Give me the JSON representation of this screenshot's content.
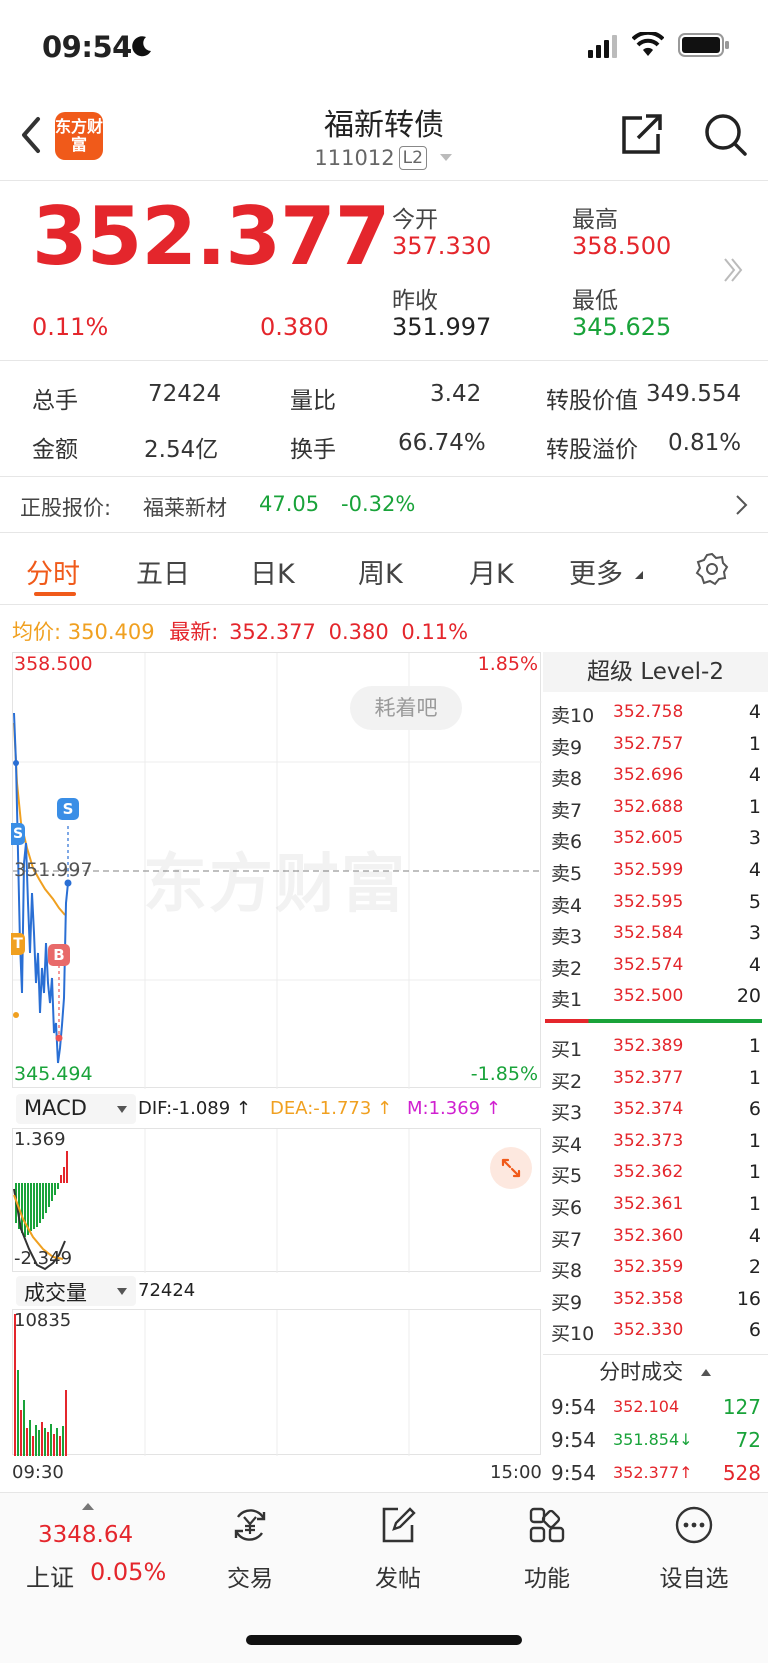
{
  "status_bar": {
    "time": "09:54"
  },
  "header": {
    "logo_text": "东方财富",
    "title": "福新转债",
    "code": "111012",
    "level_badge": "L2"
  },
  "quote": {
    "price": "352.377",
    "change_pct": "0.11%",
    "change": "0.380",
    "open_label": "今开",
    "open": "357.330",
    "high_label": "最高",
    "high": "358.500",
    "prev_close_label": "昨收",
    "prev_close": "351.997",
    "low_label": "最低",
    "low": "345.625"
  },
  "stats": {
    "volume_label": "总手",
    "volume": "72424",
    "vol_ratio_label": "量比",
    "vol_ratio": "3.42",
    "conv_value_label": "转股价值",
    "conv_value": "349.554",
    "amount_label": "金额",
    "amount": "2.54亿",
    "turnover_label": "换手",
    "turnover": "66.74%",
    "premium_label": "转股溢价",
    "premium": "0.81%"
  },
  "underlying": {
    "label": "正股报价:",
    "name": "福莱新材",
    "price": "47.05",
    "change_pct": "-0.32%"
  },
  "tabs": [
    {
      "label": "分时",
      "active": true
    },
    {
      "label": "五日",
      "active": false
    },
    {
      "label": "日K",
      "active": false
    },
    {
      "label": "周K",
      "active": false
    },
    {
      "label": "月K",
      "active": false
    },
    {
      "label": "更多",
      "active": false
    }
  ],
  "chart_header": {
    "avg_label": "均价:",
    "avg_value": "350.409",
    "latest_label": "最新:",
    "latest_value": "352.377",
    "latest_change": "0.380",
    "latest_pct": "0.11%"
  },
  "chart": {
    "top_price": "358.500",
    "top_pct": "1.85%",
    "mid_price": "351.997",
    "bottom_price": "345.494",
    "bottom_pct": "-1.85%",
    "bubble": "耗着吧",
    "watermark": "东方财富",
    "marker_s": "S",
    "marker_b": "B",
    "marker_t": "T",
    "time_start": "09:30",
    "time_end": "15:00"
  },
  "chart_data": {
    "type": "line",
    "ylim": [
      345.494,
      358.5
    ],
    "series": []
  },
  "macd": {
    "selector": "MACD",
    "dif": "DIF:-1.089 ↑",
    "dea": "DEA:-1.773 ↑",
    "m": "M:1.369 ↑",
    "top": "1.369",
    "bottom": "-2.349"
  },
  "volume_panel": {
    "selector": "成交量",
    "value": "72424",
    "top": "10835"
  },
  "order_book": {
    "title": "超级 Level-2",
    "asks": [
      {
        "label": "卖10",
        "price": "352.758",
        "qty": "4"
      },
      {
        "label": "卖9",
        "price": "352.757",
        "qty": "1"
      },
      {
        "label": "卖8",
        "price": "352.696",
        "qty": "4"
      },
      {
        "label": "卖7",
        "price": "352.688",
        "qty": "1"
      },
      {
        "label": "卖6",
        "price": "352.605",
        "qty": "3"
      },
      {
        "label": "卖5",
        "price": "352.599",
        "qty": "4"
      },
      {
        "label": "卖4",
        "price": "352.595",
        "qty": "5"
      },
      {
        "label": "卖3",
        "price": "352.584",
        "qty": "3"
      },
      {
        "label": "卖2",
        "price": "352.574",
        "qty": "4"
      },
      {
        "label": "卖1",
        "price": "352.500",
        "qty": "20"
      }
    ],
    "bids": [
      {
        "label": "买1",
        "price": "352.389",
        "qty": "1"
      },
      {
        "label": "买2",
        "price": "352.377",
        "qty": "1"
      },
      {
        "label": "买3",
        "price": "352.374",
        "qty": "6"
      },
      {
        "label": "买4",
        "price": "352.373",
        "qty": "1"
      },
      {
        "label": "买5",
        "price": "352.362",
        "qty": "1"
      },
      {
        "label": "买6",
        "price": "352.361",
        "qty": "1"
      },
      {
        "label": "买7",
        "price": "352.360",
        "qty": "4"
      },
      {
        "label": "买8",
        "price": "352.359",
        "qty": "2"
      },
      {
        "label": "买9",
        "price": "352.358",
        "qty": "16"
      },
      {
        "label": "买10",
        "price": "352.330",
        "qty": "6"
      }
    ]
  },
  "ticks": {
    "title": "分时成交",
    "rows": [
      {
        "time": "9:54",
        "price": "352.104",
        "qty": "127",
        "price_color": "#e4262c",
        "qty_color": "#19a33a",
        "arrow": ""
      },
      {
        "time": "9:54",
        "price": "351.854↓",
        "qty": "72",
        "price_color": "#19a33a",
        "qty_color": "#19a33a",
        "arrow": "down"
      },
      {
        "time": "9:54",
        "price": "352.377↑",
        "qty": "528",
        "price_color": "#e4262c",
        "qty_color": "#e4262c",
        "arrow": "up"
      }
    ]
  },
  "bottom_nav": {
    "index_value": "3348.64",
    "index_name": "上证",
    "index_pct": "0.05%",
    "items": [
      {
        "label": "交易",
        "icon": "yen-cycle-icon"
      },
      {
        "label": "发帖",
        "icon": "edit-icon"
      },
      {
        "label": "功能",
        "icon": "grid-icon"
      },
      {
        "label": "设自选",
        "icon": "more-icon"
      }
    ]
  },
  "colors": {
    "red": "#e4262c",
    "green": "#19a33a",
    "accent": "#f05a1a",
    "avg_line": "#f0a020",
    "price_line": "#2a6fd4"
  }
}
